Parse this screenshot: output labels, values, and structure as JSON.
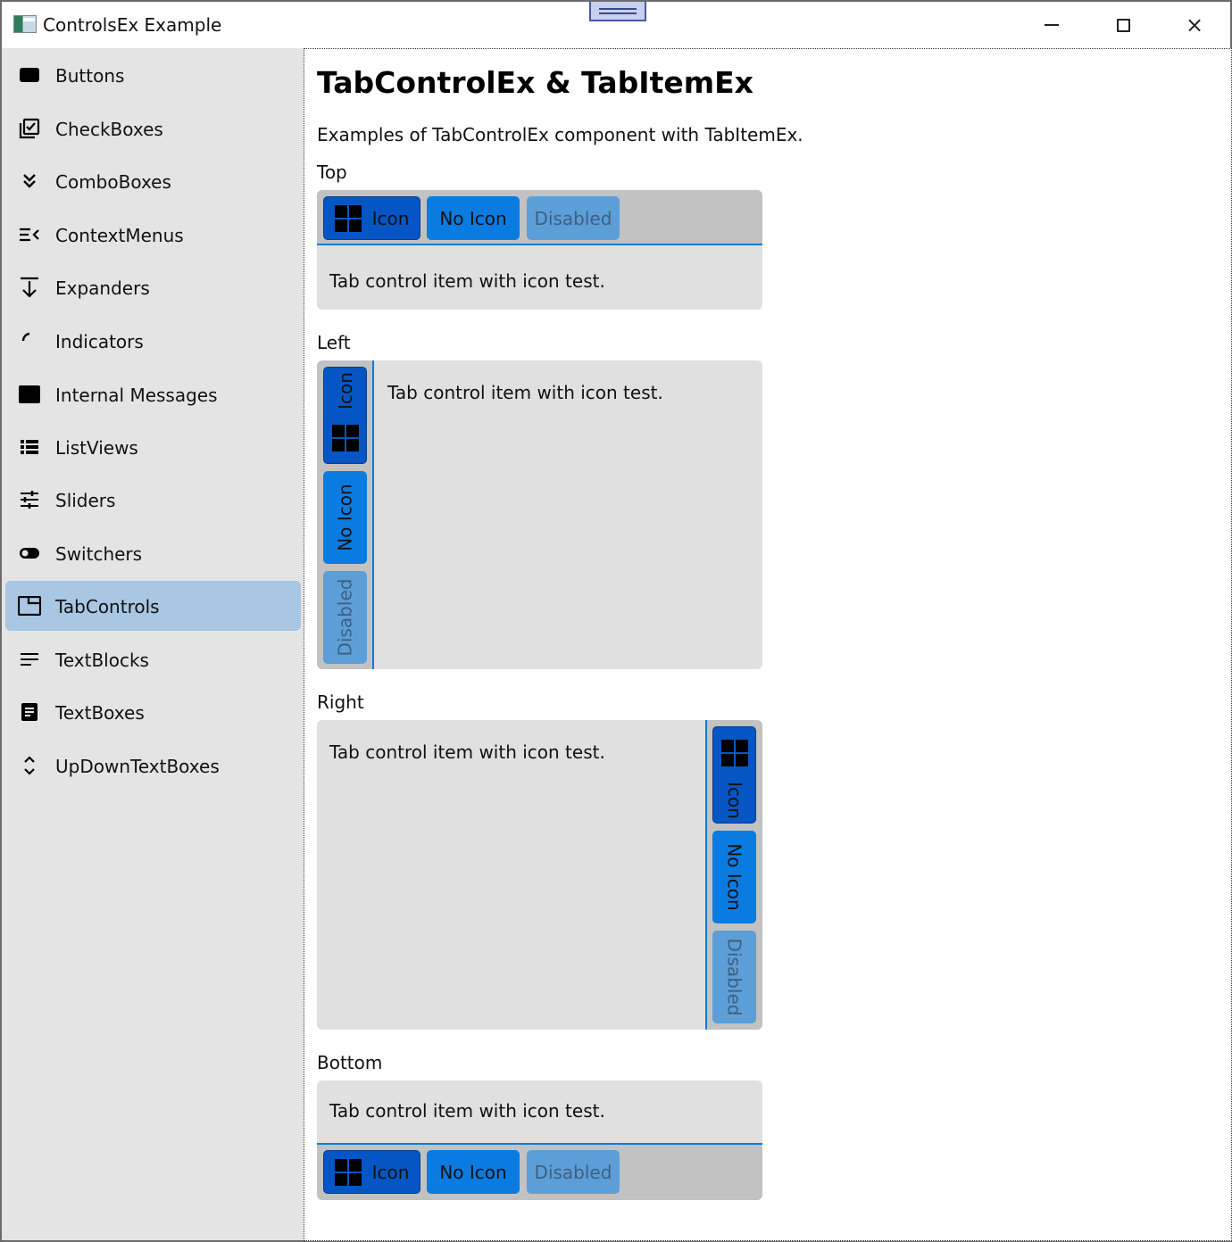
{
  "window": {
    "title": "ControlsEx Example",
    "controls": {
      "minimize": "minimize-icon",
      "maximize": "maximize-icon",
      "close": "×"
    }
  },
  "sidebar": {
    "items": [
      {
        "label": "Buttons",
        "icon": "button-icon"
      },
      {
        "label": "CheckBoxes",
        "icon": "checkbox-icon"
      },
      {
        "label": "ComboBoxes",
        "icon": "chevron-double-down-icon"
      },
      {
        "label": "ContextMenus",
        "icon": "context-menu-icon"
      },
      {
        "label": "Expanders",
        "icon": "expander-arrow-icon"
      },
      {
        "label": "Indicators",
        "icon": "indicator-arc-icon"
      },
      {
        "label": "Internal Messages",
        "icon": "message-window-icon"
      },
      {
        "label": "ListViews",
        "icon": "list-view-icon"
      },
      {
        "label": "Sliders",
        "icon": "sliders-icon"
      },
      {
        "label": "Switchers",
        "icon": "toggle-switch-icon"
      },
      {
        "label": "TabControls",
        "icon": "tab-icon",
        "active": true
      },
      {
        "label": "TextBlocks",
        "icon": "text-lines-icon"
      },
      {
        "label": "TextBoxes",
        "icon": "text-box-icon"
      },
      {
        "label": "UpDownTextBoxes",
        "icon": "up-down-arrows-icon"
      }
    ]
  },
  "main": {
    "title": "TabControlEx & TabItemEx",
    "description": "Examples of TabControlEx component with TabItemEx.",
    "sections": {
      "top": {
        "label": "Top",
        "tabs": [
          "Icon",
          "No Icon",
          "Disabled"
        ],
        "content": "Tab control item with icon test."
      },
      "left": {
        "label": "Left",
        "tabs": [
          "Icon",
          "No Icon",
          "Disabled"
        ],
        "content": "Tab control item with icon test."
      },
      "right": {
        "label": "Right",
        "tabs": [
          "Icon",
          "No Icon",
          "Disabled"
        ],
        "content": "Tab control item with icon test."
      },
      "bottom": {
        "label": "Bottom",
        "tabs": [
          "Icon",
          "No Icon",
          "Disabled"
        ],
        "content": "Tab control item with icon test."
      }
    }
  },
  "colors": {
    "accent": "#0a7be0",
    "selected_tab": "#0556c4",
    "disabled_tab": "#5c9ed8",
    "active_nav": "#a9c6e2",
    "sidebar_bg": "#e4e4e4"
  }
}
